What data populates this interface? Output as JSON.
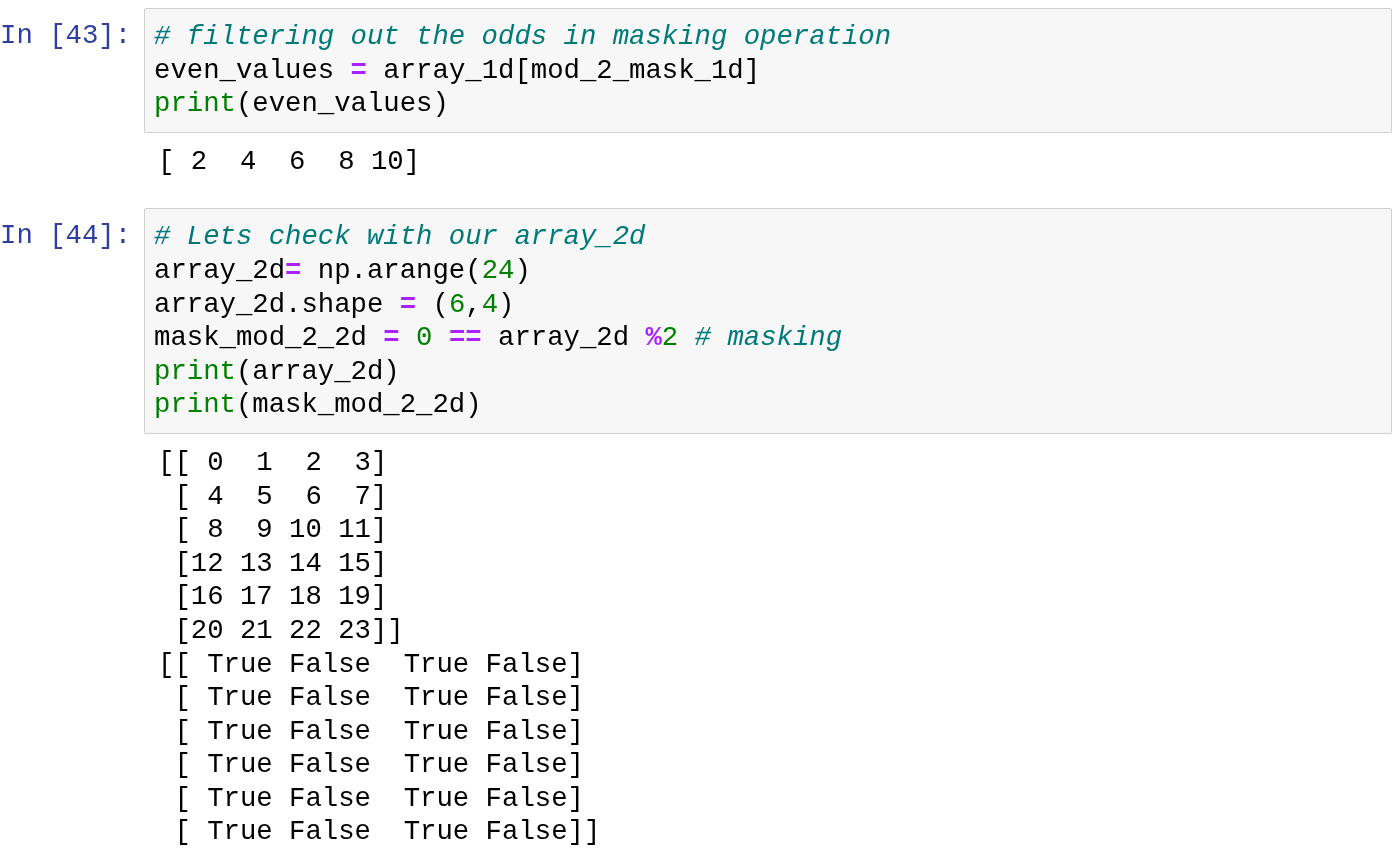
{
  "cells": [
    {
      "prompt": "In [43]:",
      "lines": [
        [
          {
            "kind": "comment",
            "t": "# filtering out the odds in masking operation"
          }
        ],
        [
          {
            "kind": "plain",
            "t": "even_values"
          },
          {
            "kind": "op",
            "t": " = "
          },
          {
            "kind": "plain",
            "t": "array_1d[mod_2_mask_1d]"
          }
        ],
        [
          {
            "kind": "builtin",
            "t": "print"
          },
          {
            "kind": "plain",
            "t": "(even_values)"
          }
        ]
      ],
      "output": [
        "[ 2  4  6  8 10]"
      ]
    },
    {
      "prompt": "In [44]:",
      "lines": [
        [
          {
            "kind": "comment",
            "t": "# Lets check with our array_2d"
          }
        ],
        [
          {
            "kind": "plain",
            "t": "array_2d"
          },
          {
            "kind": "op",
            "t": "= "
          },
          {
            "kind": "plain",
            "t": "np.arange("
          },
          {
            "kind": "num",
            "t": "24"
          },
          {
            "kind": "plain",
            "t": ")"
          }
        ],
        [
          {
            "kind": "plain",
            "t": "array_2d.shape"
          },
          {
            "kind": "op",
            "t": " = "
          },
          {
            "kind": "plain",
            "t": "("
          },
          {
            "kind": "num",
            "t": "6"
          },
          {
            "kind": "plain",
            "t": ","
          },
          {
            "kind": "num",
            "t": "4"
          },
          {
            "kind": "plain",
            "t": ")"
          }
        ],
        [
          {
            "kind": "plain",
            "t": "mask_mod_2_2d"
          },
          {
            "kind": "op",
            "t": " = "
          },
          {
            "kind": "num",
            "t": "0"
          },
          {
            "kind": "op",
            "t": " == "
          },
          {
            "kind": "plain",
            "t": "array_2d "
          },
          {
            "kind": "op",
            "t": "%"
          },
          {
            "kind": "num",
            "t": "2"
          },
          {
            "kind": "comment",
            "t": " # masking"
          }
        ],
        [
          {
            "kind": "builtin",
            "t": "print"
          },
          {
            "kind": "plain",
            "t": "(array_2d)"
          }
        ],
        [
          {
            "kind": "builtin",
            "t": "print"
          },
          {
            "kind": "plain",
            "t": "(mask_mod_2_2d)"
          }
        ]
      ],
      "output": [
        "[[ 0  1  2  3]",
        " [ 4  5  6  7]",
        " [ 8  9 10 11]",
        " [12 13 14 15]",
        " [16 17 18 19]",
        " [20 21 22 23]]",
        "[[ True False  True False]",
        " [ True False  True False]",
        " [ True False  True False]",
        " [ True False  True False]",
        " [ True False  True False]",
        " [ True False  True False]]"
      ]
    }
  ]
}
